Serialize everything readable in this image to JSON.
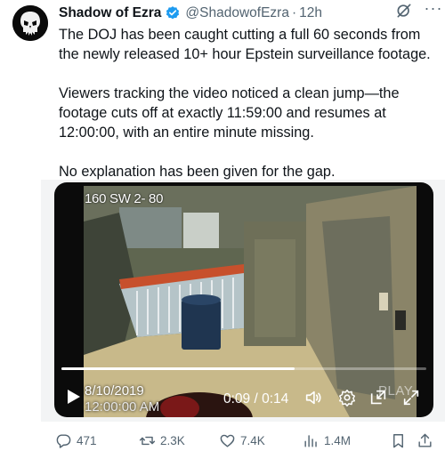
{
  "post": {
    "author_name": "Shadow of Ezra",
    "handle": "@ShadowofEzra",
    "separator": "·",
    "time": "12h",
    "more_label": "···",
    "paragraphs": [
      "The DOJ has been caught cutting a full 60 seconds from the newly released 10+ hour Epstein surveillance footage.",
      "Viewers tracking the video noticed a clean jump—the footage cuts off at exactly 11:59:00 and resumes at 12:00:00, with an entire minute missing.",
      "No explanation has been given for the gap."
    ]
  },
  "video": {
    "camera_label": "160 SW 2- 80",
    "date_stamp": "8/10/2019",
    "time_stamp": "12:00:00 AM",
    "elapsed": "0:09 / 0:14",
    "overlay_text": "PLAY",
    "progress_fraction": 0.64
  },
  "actions": {
    "replies": "471",
    "reposts": "2.3K",
    "likes": "7.4K",
    "views": "1.4M"
  },
  "colors": {
    "verified": "#1d9bf0",
    "muted": "#536471",
    "text": "#0f1419"
  },
  "icons": [
    "verified-badge-icon",
    "grok-icon",
    "more-icon",
    "play-icon",
    "volume-icon",
    "settings-icon",
    "pip-icon",
    "fullscreen-icon",
    "reply-icon",
    "repost-icon",
    "like-icon",
    "views-icon",
    "bookmark-icon",
    "share-icon"
  ]
}
